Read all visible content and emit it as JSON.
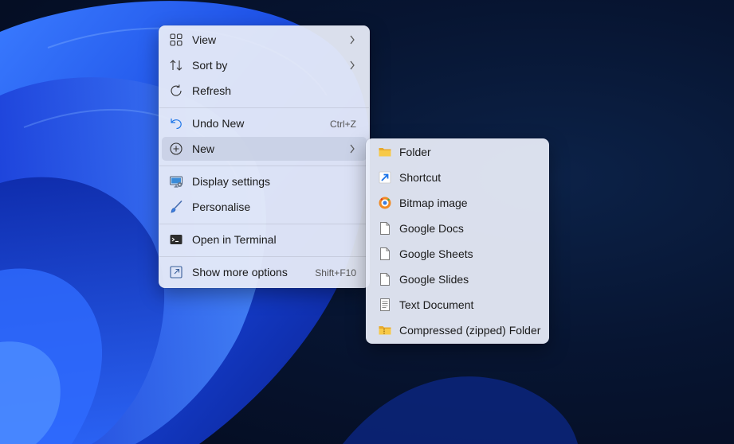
{
  "context_menu": {
    "items": [
      {
        "label": "View",
        "icon": "view-icon",
        "has_submenu": true
      },
      {
        "label": "Sort by",
        "icon": "sort-icon",
        "has_submenu": true
      },
      {
        "label": "Refresh",
        "icon": "refresh-icon"
      },
      {
        "label": "Undo New",
        "icon": "undo-icon",
        "shortcut": "Ctrl+Z"
      },
      {
        "label": "New",
        "icon": "new-icon",
        "has_submenu": true,
        "highlighted": true
      },
      {
        "label": "Display settings",
        "icon": "display-settings-icon"
      },
      {
        "label": "Personalise",
        "icon": "brush-icon"
      },
      {
        "label": "Open in Terminal",
        "icon": "terminal-icon"
      },
      {
        "label": "Show more options",
        "icon": "show-more-options-icon",
        "shortcut": "Shift+F10"
      }
    ]
  },
  "new_submenu": {
    "items": [
      {
        "label": "Folder",
        "icon": "folder-icon"
      },
      {
        "label": "Shortcut",
        "icon": "shortcut-icon"
      },
      {
        "label": "Bitmap image",
        "icon": "bitmap-image-icon"
      },
      {
        "label": "Google Docs",
        "icon": "blank-document-icon"
      },
      {
        "label": "Google Sheets",
        "icon": "blank-document-icon"
      },
      {
        "label": "Google Slides",
        "icon": "blank-document-icon"
      },
      {
        "label": "Text Document",
        "icon": "text-document-icon"
      },
      {
        "label": "Compressed (zipped) Folder",
        "icon": "zipped-folder-icon"
      }
    ]
  },
  "colors": {
    "accent": "#1a73e8",
    "wallpaper_blue": "#1e4ee6",
    "folder_yellow": "#f5c242"
  }
}
